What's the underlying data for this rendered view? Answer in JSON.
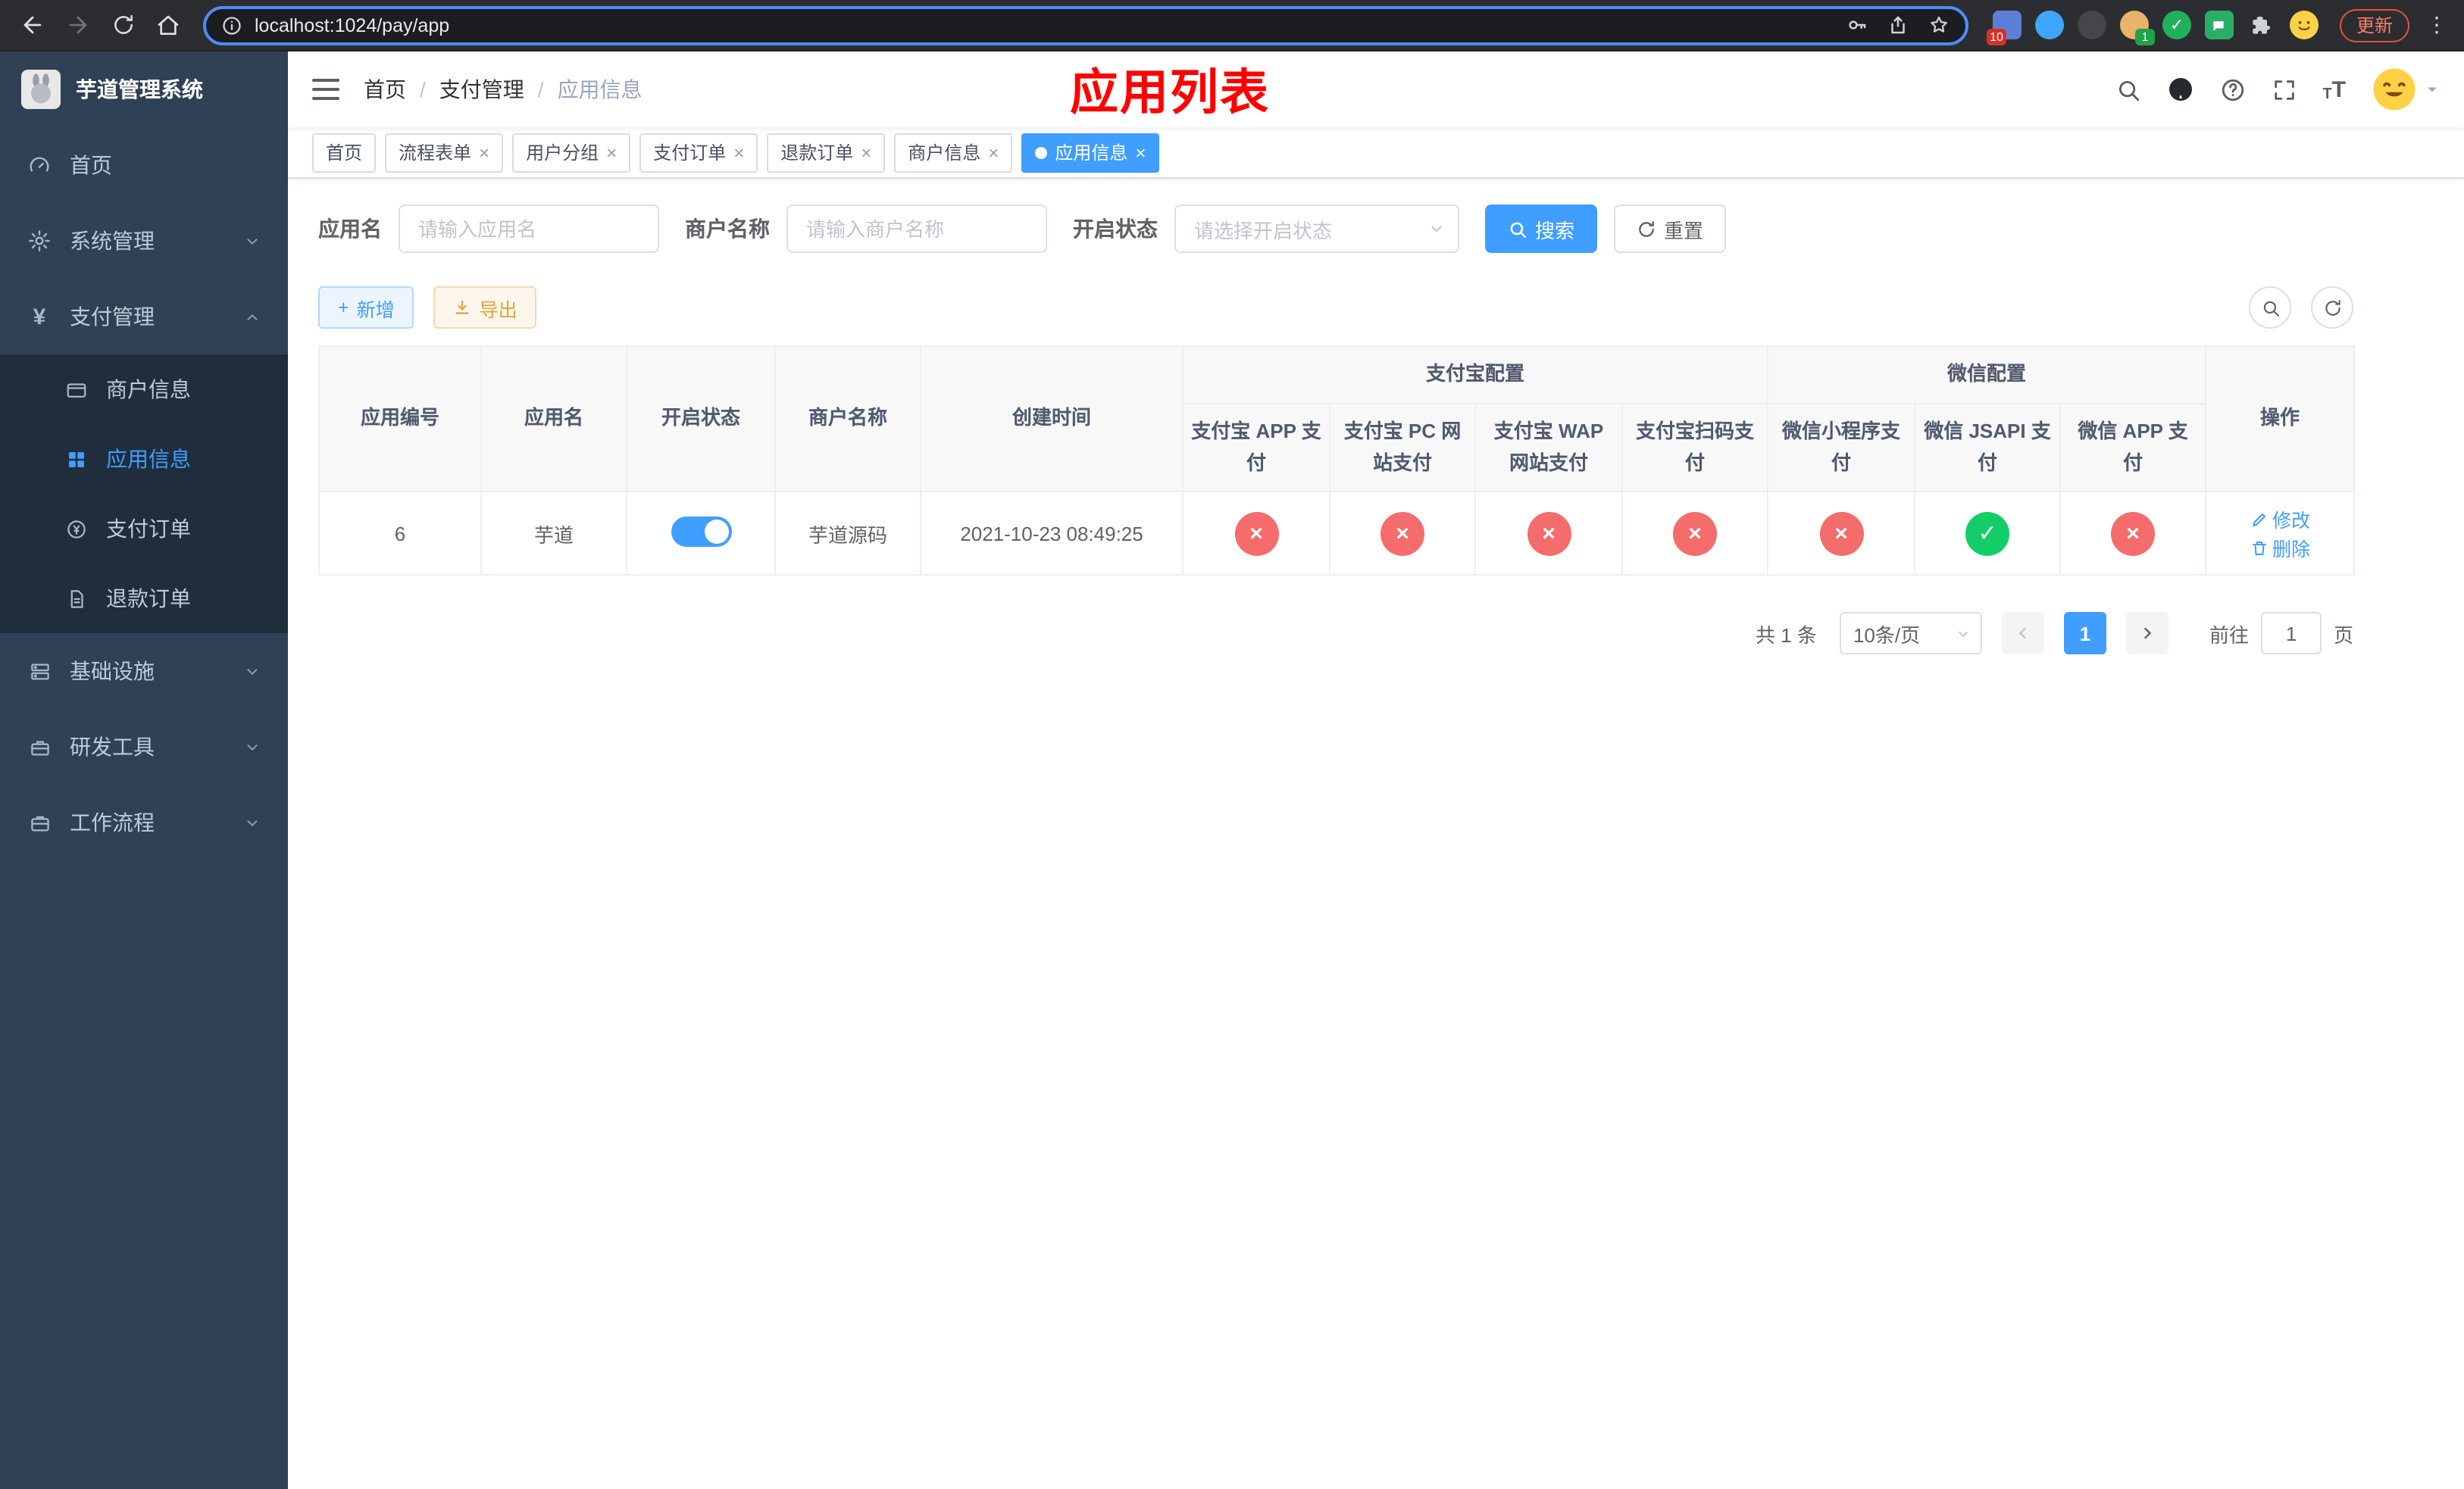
{
  "colors": {
    "accent": "#409eff",
    "danger": "#f56c6c",
    "success": "#13ce66",
    "annotation_red": "#ff0000",
    "sidebar_bg": "#304156",
    "submenu_bg": "#1f2d3d"
  },
  "browser": {
    "url": "localhost:1024/pay/app",
    "update_label": "更新",
    "extensions_badge": "10",
    "profile_badge": "1"
  },
  "sidebar": {
    "title": "芋道管理系统",
    "items": [
      {
        "label": "首页"
      },
      {
        "label": "系统管理"
      },
      {
        "label": "支付管理",
        "children": [
          {
            "label": "商户信息"
          },
          {
            "label": "应用信息"
          },
          {
            "label": "支付订单"
          },
          {
            "label": "退款订单"
          }
        ]
      },
      {
        "label": "基础设施"
      },
      {
        "label": "研发工具"
      },
      {
        "label": "工作流程"
      }
    ]
  },
  "header": {
    "breadcrumb": [
      "首页",
      "支付管理",
      "应用信息"
    ],
    "page_title": "应用列表"
  },
  "tabs": [
    {
      "label": "首页"
    },
    {
      "label": "流程表单"
    },
    {
      "label": "用户分组"
    },
    {
      "label": "支付订单"
    },
    {
      "label": "退款订单"
    },
    {
      "label": "商户信息"
    },
    {
      "label": "应用信息"
    }
  ],
  "filters": {
    "app_name": {
      "label": "应用名",
      "placeholder": "请输入应用名",
      "value": ""
    },
    "merchant_name": {
      "label": "商户名称",
      "placeholder": "请输入商户名称",
      "value": ""
    },
    "status": {
      "label": "开启状态",
      "placeholder": "请选择开启状态",
      "value": ""
    },
    "search_label": "搜索",
    "reset_label": "重置"
  },
  "toolbar": {
    "add_label": "新增",
    "export_label": "导出"
  },
  "table": {
    "columns": [
      "应用编号",
      "应用名",
      "开启状态",
      "商户名称",
      "创建时间"
    ],
    "groups": {
      "alipay": "支付宝配置",
      "wechat": "微信配置",
      "actions": "操作"
    },
    "sub_columns": [
      "支付宝 APP 支付",
      "支付宝 PC 网站支付",
      "支付宝 WAP 网站支付",
      "支付宝扫码支付",
      "微信小程序支付",
      "微信 JSAPI 支付",
      "微信 APP 支付"
    ],
    "rows": [
      {
        "app_id": "6",
        "app_name": "芋道",
        "status_on": true,
        "merchant_name": "芋道源码",
        "create_time": "2021-10-23 08:49:25",
        "configs": [
          false,
          false,
          false,
          false,
          false,
          true,
          false
        ],
        "edit_label": "修改",
        "delete_label": "删除"
      }
    ]
  },
  "pagination": {
    "total": "共 1 条",
    "page_size": "10条/页",
    "current_page": "1",
    "goto_label": "前往",
    "goto_value": "1",
    "goto_unit": "页"
  }
}
